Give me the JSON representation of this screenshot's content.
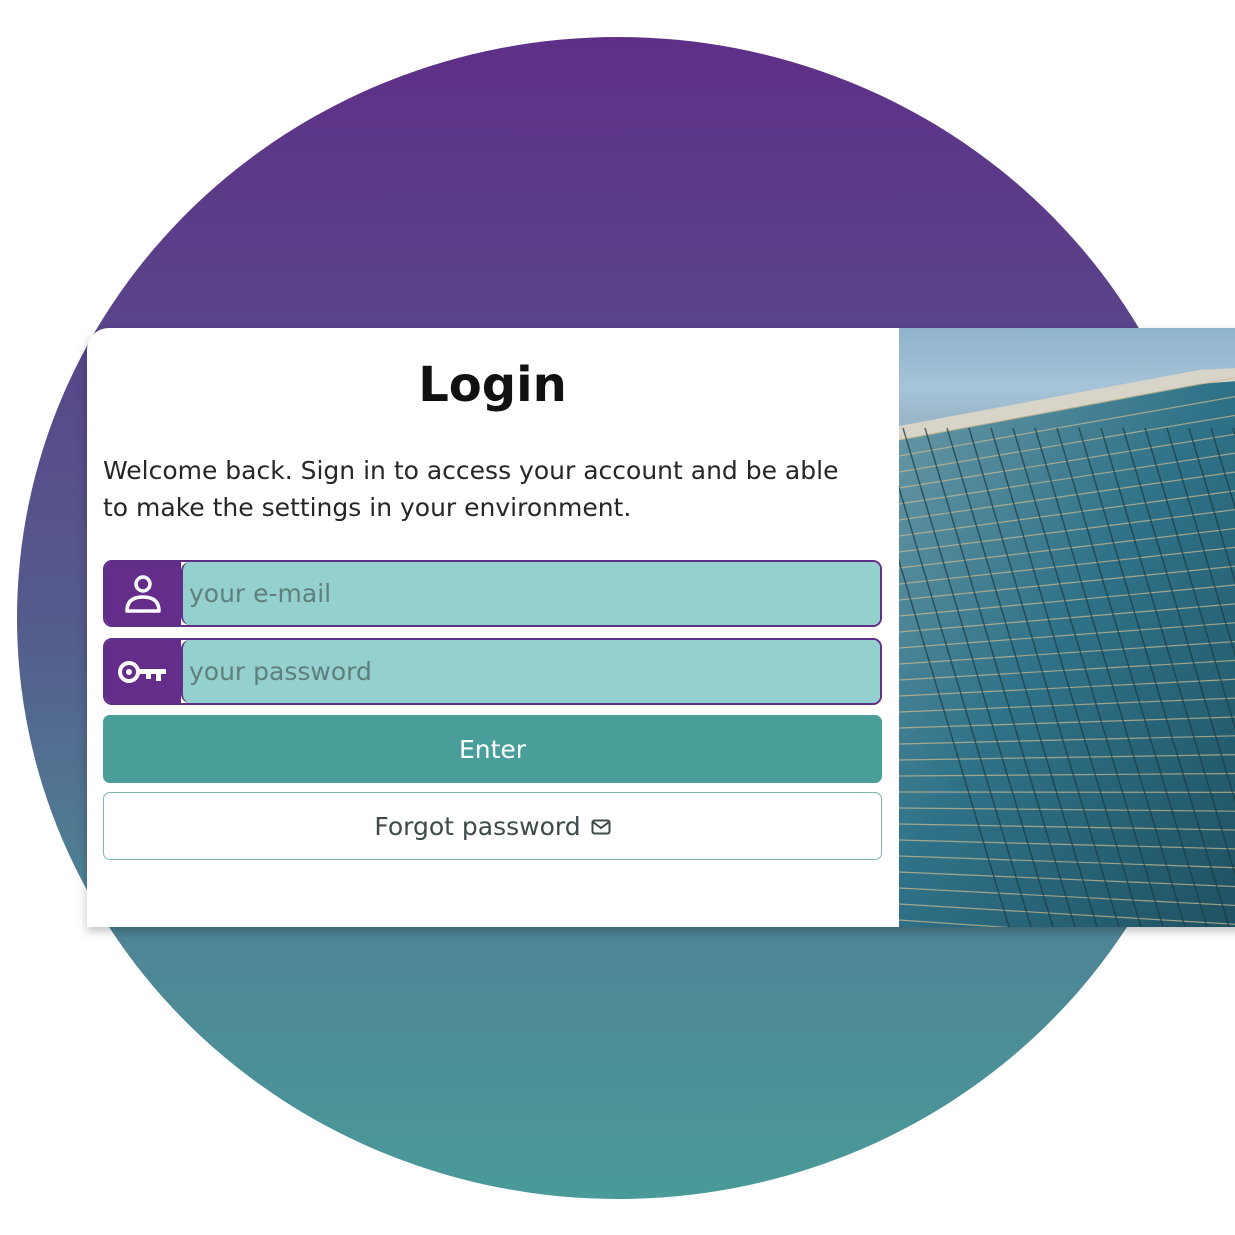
{
  "login": {
    "title": "Login",
    "welcome_text": "Welcome back. Sign in to access your account and be able to make the settings in your environment.",
    "email": {
      "icon": "user-icon",
      "placeholder": "your e-mail",
      "value": ""
    },
    "password": {
      "icon": "key-icon",
      "placeholder": "your password",
      "value": ""
    },
    "enter_label": "Enter",
    "forgot_label": "Forgot password",
    "forgot_icon": "envelope-icon"
  },
  "theme": {
    "primary": "#642d8a",
    "accent": "#4a9e9a",
    "input_bg": "#94d0cd"
  },
  "image": {
    "subject": "glass office building facade"
  }
}
